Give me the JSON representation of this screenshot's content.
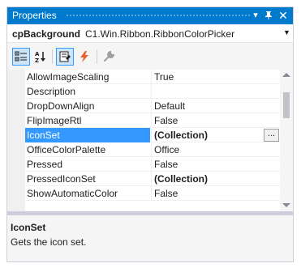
{
  "window": {
    "title": "Properties",
    "buttons": {
      "dropdown": "▾",
      "pin": "🖈",
      "close": "✕"
    }
  },
  "object": {
    "name": "cpBackground",
    "type": "C1.Win.Ribbon.RibbonColorPicker",
    "dropdown": "▼"
  },
  "toolbar": {
    "buttons": [
      {
        "icon": "categorized-icon",
        "active": true
      },
      {
        "icon": "alphabetical-icon",
        "active": false
      },
      {
        "icon": "properties-icon",
        "active": true
      },
      {
        "icon": "events-icon",
        "active": false
      },
      {
        "icon": "property-pages-icon",
        "active": false
      }
    ]
  },
  "properties": [
    {
      "name": "AllowImageScaling",
      "value": "True",
      "bold": false
    },
    {
      "name": "Description",
      "value": "",
      "bold": false
    },
    {
      "name": "DropDownAlign",
      "value": "Default",
      "bold": false
    },
    {
      "name": "FlipImageRtl",
      "value": "False",
      "bold": false
    },
    {
      "name": "IconSet",
      "value": "(Collection)",
      "bold": true,
      "selected": true,
      "ellipsis": "..."
    },
    {
      "name": "OfficeColorPalette",
      "value": "Office",
      "bold": false
    },
    {
      "name": "Pressed",
      "value": "False",
      "bold": false
    },
    {
      "name": "PressedIconSet",
      "value": "(Collection)",
      "bold": true
    },
    {
      "name": "ShowAutomaticColor",
      "value": "False",
      "bold": false
    }
  ],
  "description": {
    "title": "IconSet",
    "text": "Gets the icon set."
  },
  "colors": {
    "titlebar": "#007acc",
    "selection": "#3399ff",
    "events_icon": "#e8632b"
  }
}
